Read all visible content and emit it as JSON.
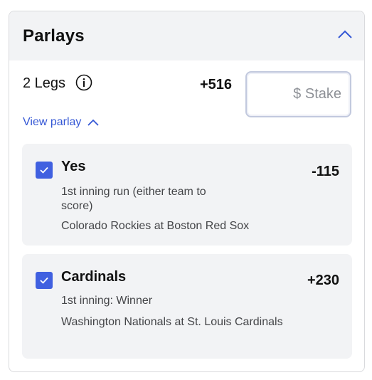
{
  "header": {
    "title": "Parlays"
  },
  "summary": {
    "legs_label": "2 Legs",
    "total_odds": "+516",
    "stake_placeholder": "$ Stake",
    "view_parlay_label": "View parlay"
  },
  "legs": [
    {
      "selection": "Yes",
      "odds": "-115",
      "market": "1st inning run (either team to score)",
      "event": "Colorado Rockies at Boston Red Sox",
      "checked": true
    },
    {
      "selection": "Cardinals",
      "odds": "+230",
      "market": "1st inning: Winner",
      "event": "Washington Nationals at St. Louis Cardinals",
      "checked": true
    }
  ],
  "icons": {
    "collapse": "chevron-up-icon",
    "info": "info-icon",
    "view_parlay": "chevron-up-icon",
    "checkbox": "checkmark-icon"
  },
  "colors": {
    "accent": "#3457d5",
    "checkbox": "#4060e0",
    "panel_bg": "#f2f3f5"
  }
}
